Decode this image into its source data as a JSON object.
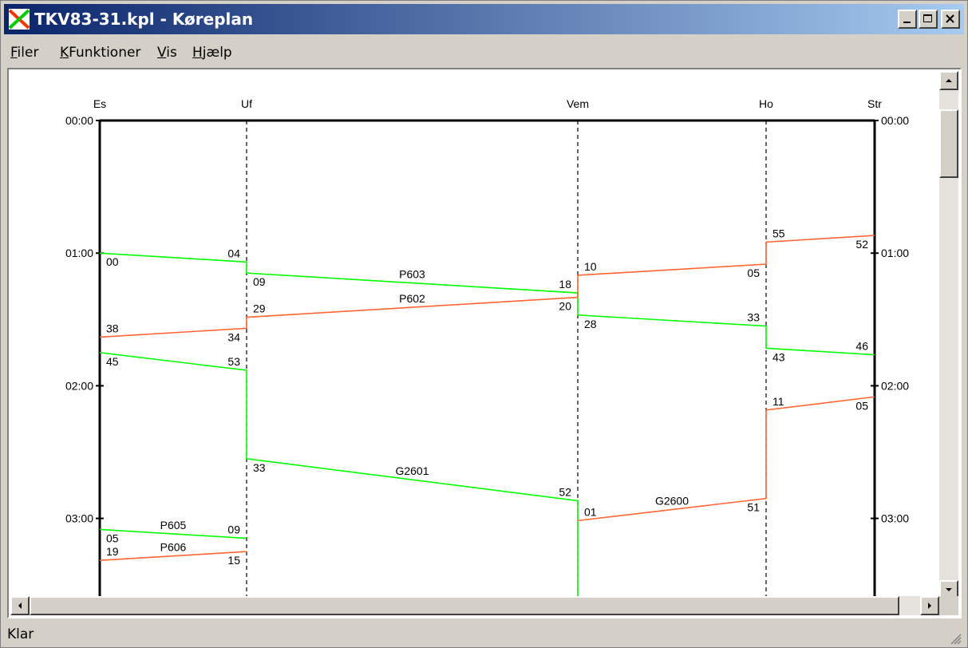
{
  "window": {
    "title": "TKV83-31.kpl - Køreplan",
    "minimize_icon": "minimize-icon",
    "maximize_icon": "maximize-icon",
    "close_icon": "close-icon"
  },
  "menu": [
    {
      "accel": "F",
      "rest": "iler"
    },
    {
      "accel": "K",
      "rest": "Funktioner"
    },
    {
      "accel": "V",
      "rest": "is"
    },
    {
      "accel": "H",
      "rest": "jælp"
    }
  ],
  "status": {
    "text": "Klar"
  },
  "colors": {
    "passenger": "#00ff00",
    "freight": "#ff6633",
    "axis": "#000000"
  },
  "chart_data": {
    "type": "line",
    "title": "",
    "stations": [
      "Es",
      "Uf",
      "Vem",
      "Ho",
      "Str"
    ],
    "time_ticks": [
      "00:00",
      "01:00",
      "02:00",
      "03:00"
    ],
    "trains": [
      {
        "name": "P603",
        "color": "#00ff00",
        "points": [
          [
            "Es",
            "01:00"
          ],
          [
            "Uf",
            "01:04"
          ],
          [
            "Uf",
            "01:09"
          ],
          [
            "Vem",
            "01:18"
          ],
          [
            "Vem",
            "01:28"
          ],
          [
            "Ho",
            "01:33"
          ],
          [
            "Ho",
            "01:43"
          ],
          [
            "Str",
            "01:46"
          ]
        ],
        "labels": [
          "00",
          "04",
          "09",
          "18",
          "28",
          "33",
          "43",
          "46"
        ]
      },
      {
        "name": "P602",
        "color": "#ff6633",
        "points": [
          [
            "Str",
            "00:52"
          ],
          [
            "Ho",
            "00:55"
          ],
          [
            "Ho",
            "01:05"
          ],
          [
            "Vem",
            "01:10"
          ],
          [
            "Vem",
            "01:20"
          ],
          [
            "Uf",
            "01:29"
          ],
          [
            "Uf",
            "01:34"
          ],
          [
            "Es",
            "01:38"
          ]
        ],
        "labels": [
          "52",
          "55",
          "05",
          "10",
          "20",
          "29",
          "34",
          "38"
        ]
      },
      {
        "name": "G2601",
        "color": "#00ff00",
        "points": [
          [
            "Es",
            "01:45"
          ],
          [
            "Uf",
            "01:53"
          ],
          [
            "Uf",
            "02:33"
          ],
          [
            "Vem",
            "02:52"
          ],
          [
            "Vem",
            "03:40"
          ]
        ],
        "labels": [
          "45",
          "53",
          "33",
          "52"
        ]
      },
      {
        "name": "G2600",
        "color": "#ff6633",
        "points": [
          [
            "Str",
            "02:05"
          ],
          [
            "Ho",
            "02:11"
          ],
          [
            "Ho",
            "02:51"
          ],
          [
            "Vem",
            "03:01"
          ]
        ],
        "labels": [
          "05",
          "11",
          "51",
          "01"
        ]
      },
      {
        "name": "P605",
        "color": "#00ff00",
        "points": [
          [
            "Es",
            "03:05"
          ],
          [
            "Uf",
            "03:09"
          ]
        ],
        "labels": [
          "05",
          "09"
        ]
      },
      {
        "name": "P606",
        "color": "#ff6633",
        "points": [
          [
            "Uf",
            "03:15"
          ],
          [
            "Es",
            "03:19"
          ]
        ],
        "labels": [
          "15",
          "19"
        ]
      }
    ]
  }
}
